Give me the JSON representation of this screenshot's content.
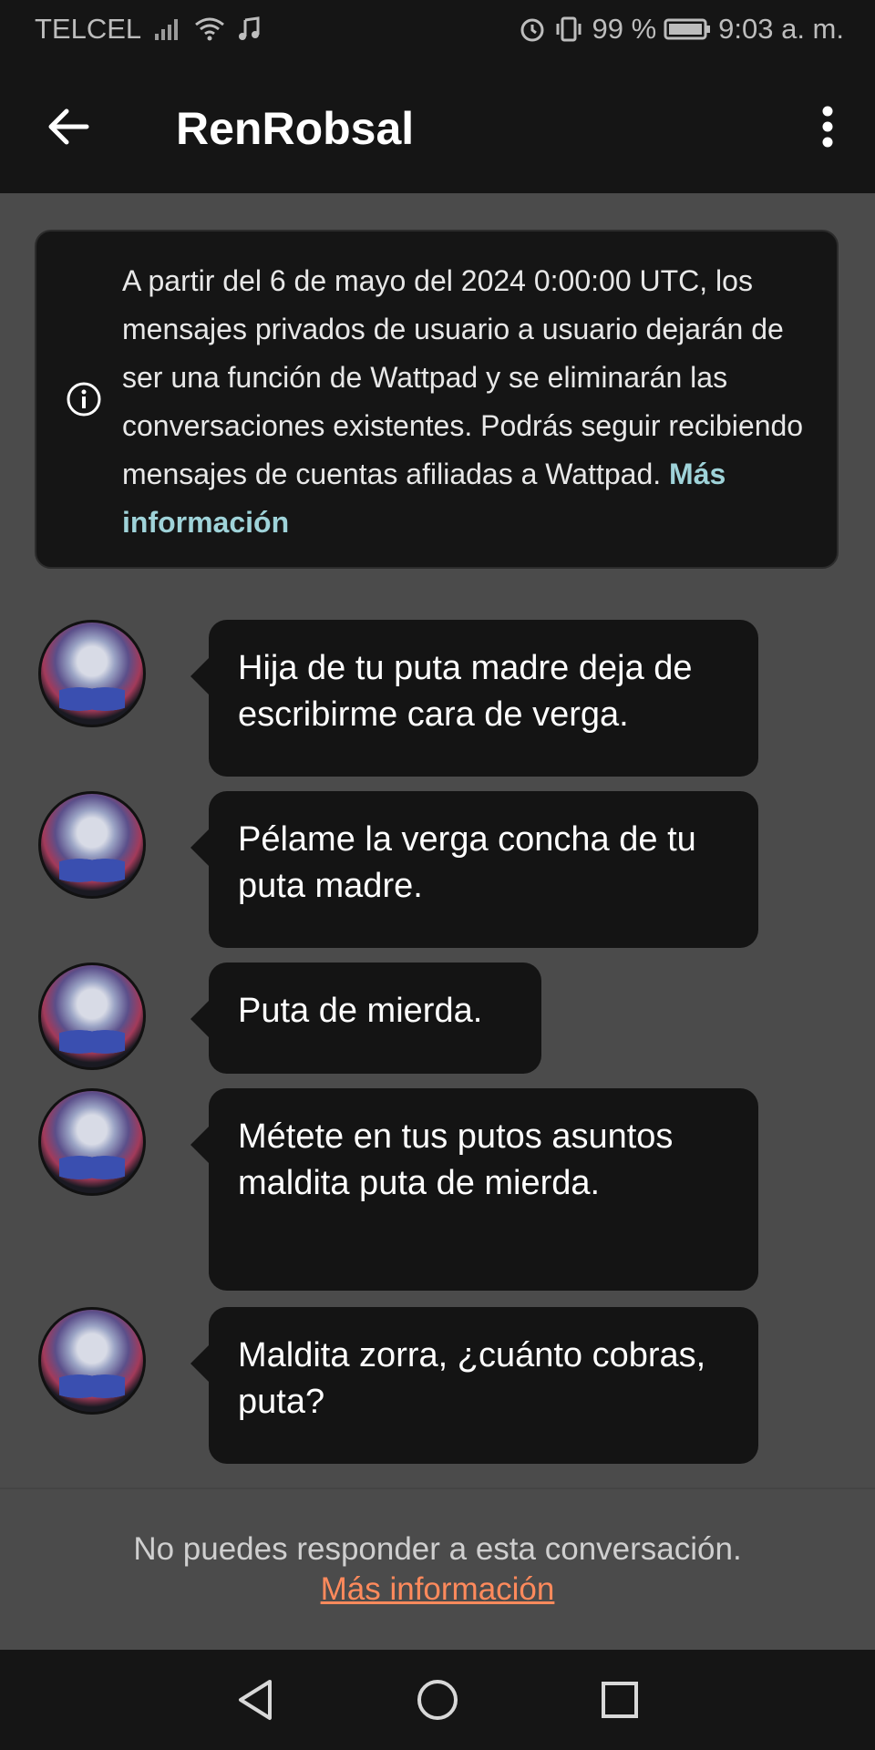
{
  "status_bar": {
    "carrier": "TELCEL",
    "battery_percent": "99 %",
    "time": "9:03 a. m."
  },
  "app_bar": {
    "title": "RenRobsal",
    "back_icon": "arrow-left-icon",
    "menu_icon": "more-vertical-icon"
  },
  "notice": {
    "icon": "info-icon",
    "text": "A partir del 6 de mayo del 2024 0:00:00 UTC, los mensajes privados de usuario a usuario dejarán de ser una función de Wattpad y se eliminarán las conversaciones existentes. Podrás seguir recibiendo mensajes de cuentas afiliadas a Wattpad.",
    "link": "Más información"
  },
  "messages": [
    {
      "text": "Hija de tu puta madre deja de escribirme cara de verga."
    },
    {
      "text": "Pélame la verga concha de tu puta madre."
    },
    {
      "text": "Puta de mierda."
    },
    {
      "text": "Métete en tus putos asuntos maldita puta de mierda."
    },
    {
      "text": "Maldita zorra,  ¿cuánto cobras, puta?"
    }
  ],
  "footer": {
    "text": "No puedes responder a esta conversación.",
    "link": "Más información"
  },
  "nav": {
    "back_icon": "triangle-back-icon",
    "home_icon": "circle-home-icon",
    "recents_icon": "square-recents-icon"
  },
  "colors": {
    "background": "#4b4b4b",
    "surface": "#151515",
    "bubble": "#141414",
    "notice_link": "#9fd3d9",
    "footer_link": "#ff8a5c"
  }
}
